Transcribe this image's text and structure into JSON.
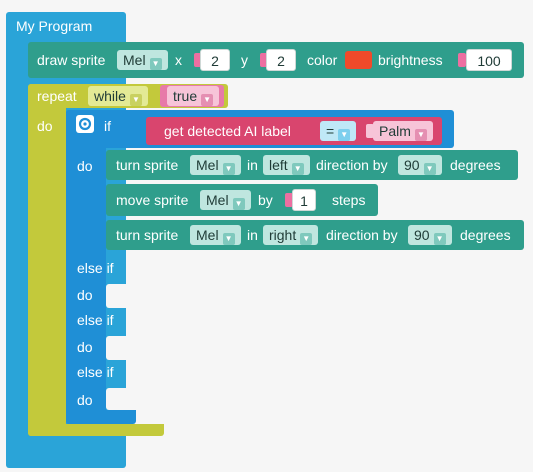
{
  "program": {
    "title": "My Program",
    "draw": {
      "prefix": "draw sprite",
      "sprite": "Mel",
      "x_label": "x",
      "x_value": "2",
      "y_label": "y",
      "y_value": "2",
      "color_label": "color",
      "color_value": "#f04a2a",
      "brightness_label": "brightness",
      "brightness_value": "100"
    },
    "repeat": {
      "label": "repeat",
      "mode": "while",
      "condition": "true",
      "do_label": "do"
    },
    "if_block": {
      "if_label": "if",
      "condition": {
        "left": "get detected AI label",
        "operator": "=",
        "right": "Palm"
      },
      "do_label": "do",
      "statements": [
        {
          "prefix": "turn sprite",
          "sprite": "Mel",
          "in_label": "in",
          "direction": "left",
          "by_label": "direction by",
          "value": "90",
          "suffix": "degrees"
        },
        {
          "prefix": "move sprite",
          "sprite": "Mel",
          "by_label": "by",
          "value": "1",
          "suffix": "steps"
        },
        {
          "prefix": "turn sprite",
          "sprite": "Mel",
          "in_label": "in",
          "direction": "right",
          "by_label": "direction by",
          "value": "90",
          "suffix": "degrees"
        }
      ],
      "branches": [
        {
          "else_if": "else if",
          "do": "do"
        },
        {
          "else_if": "else if",
          "do": "do"
        },
        {
          "else_if": "else if",
          "do": "do"
        }
      ]
    }
  },
  "colors": {
    "program_blue": "#2aa4d8",
    "teal": "#2f9e8c",
    "if_blue": "#1f8fd6",
    "repeat_yellow": "#c3c93b",
    "ai_pink": "#d9456e"
  }
}
